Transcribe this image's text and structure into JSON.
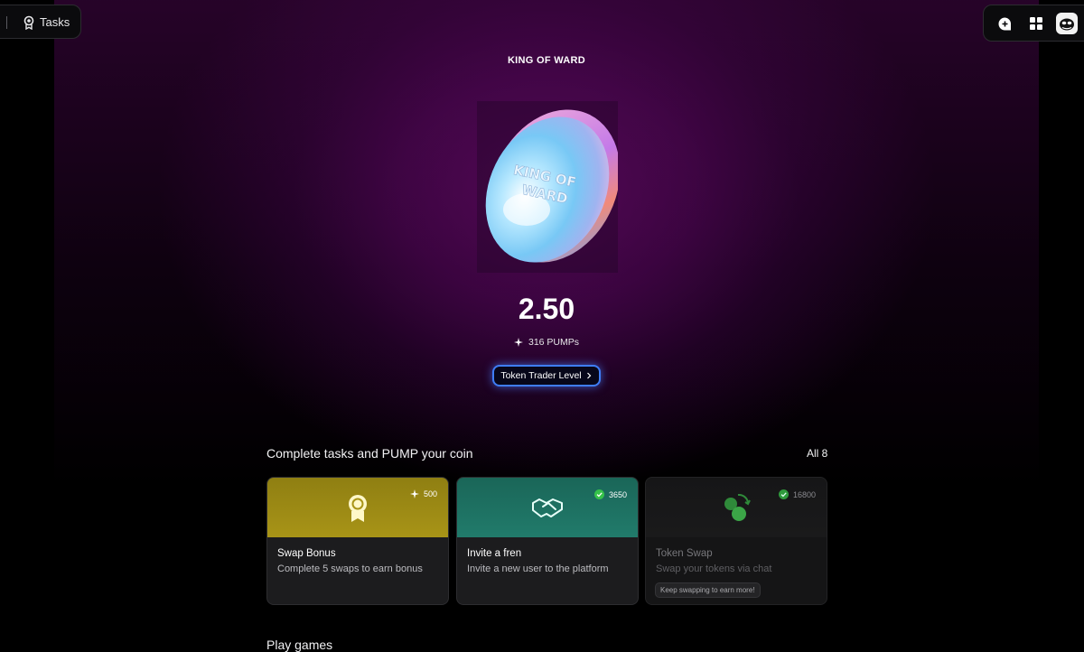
{
  "nav": {
    "tab_label": "Tasks"
  },
  "toolbar": {
    "chat_icon": "chat-icon",
    "grid_icon": "grid-icon",
    "avatar_icon": "avatar-icon"
  },
  "coin": {
    "title": "KING OF WARD",
    "art_text": "KING OF WARD",
    "value": "2.50",
    "pumps": "316 PUMPs",
    "level_label": "Token Trader Level"
  },
  "tasks": {
    "heading": "Complete tasks and PUMP your coin",
    "all_label": "All 8",
    "items": [
      {
        "title": "Swap Bonus",
        "description": "Complete 5 swaps to earn bonus",
        "reward": "500",
        "reward_icon": "sparkle-icon",
        "icon": "badge-icon",
        "color": "#a89417"
      },
      {
        "title": "Invite a fren",
        "description": "Invite a new user to the platform",
        "reward": "3650",
        "reward_icon": "check-circle-icon",
        "icon": "handshake-icon",
        "color": "#1f7566"
      },
      {
        "title": "Token Swap",
        "description": "Swap your tokens via chat",
        "reward": "16800",
        "reward_icon": "check-circle-icon",
        "icon": "swap-icon",
        "color": "#3ba547",
        "hint": "Keep swapping to earn more!"
      }
    ]
  },
  "games": {
    "heading": "Play games"
  }
}
